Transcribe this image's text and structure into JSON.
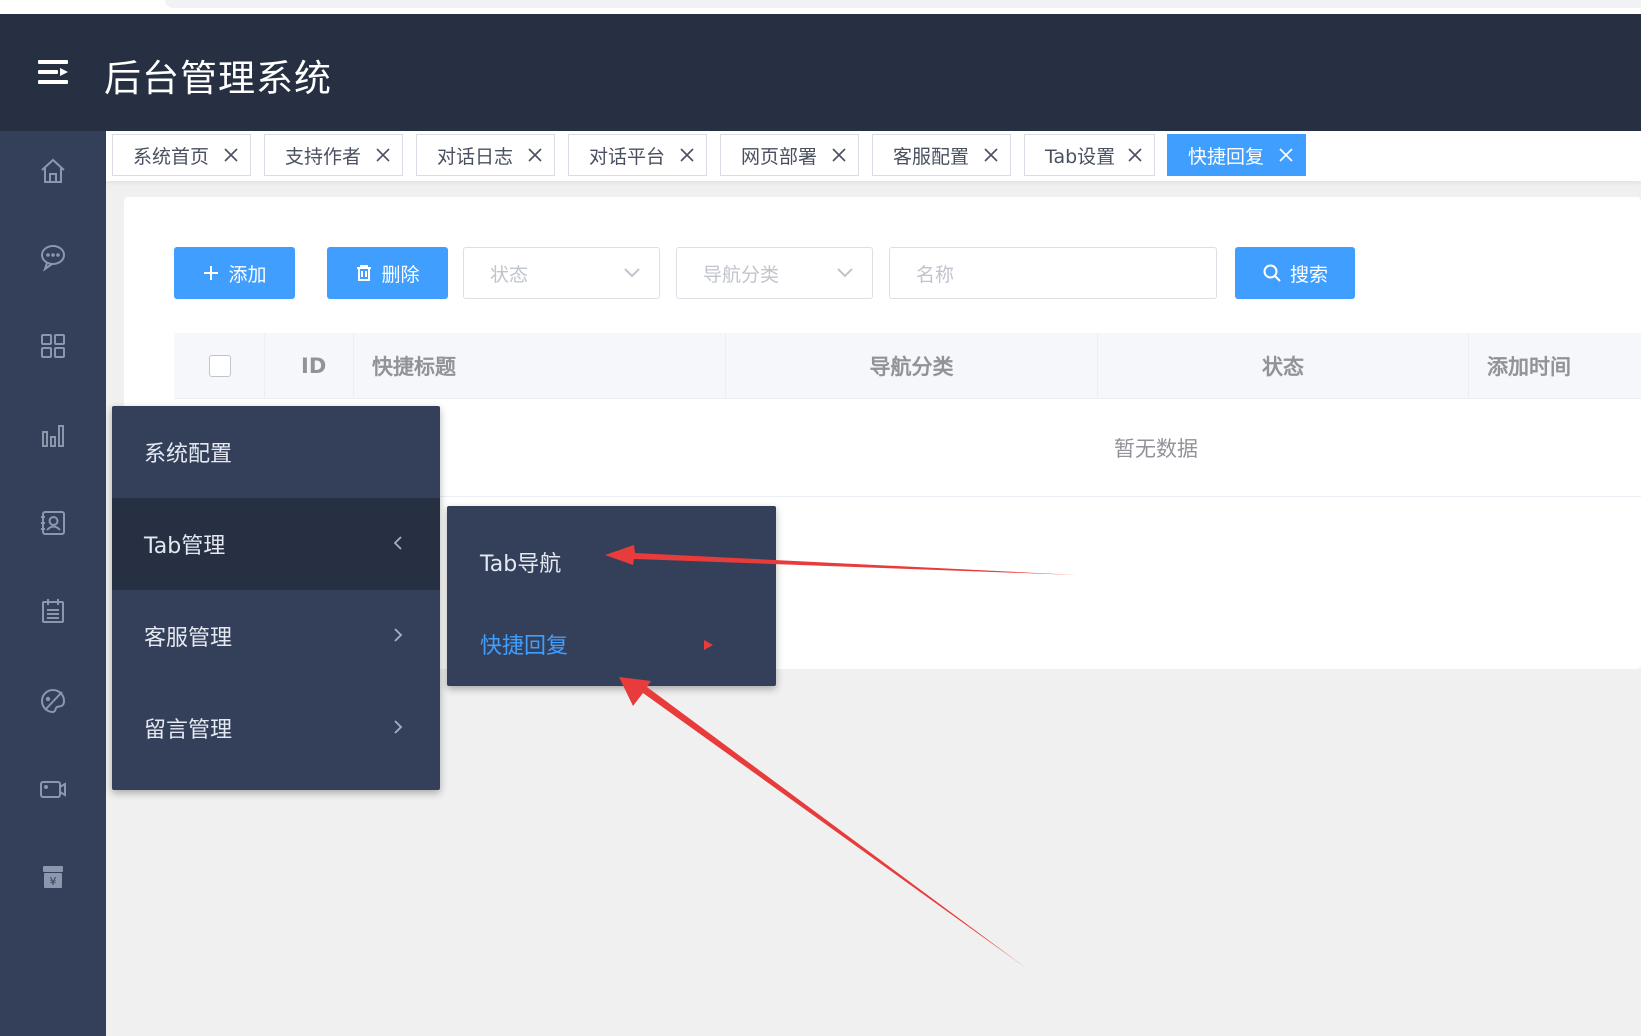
{
  "header": {
    "title": "后台管理系统",
    "menu_icon": "hamburger-menu-icon"
  },
  "sidebar": {
    "icons": [
      "home-icon",
      "chat-icon",
      "grid-icon",
      "bar-chart-icon",
      "contact-card-icon",
      "calendar-icon",
      "palette-icon",
      "video-icon",
      "payment-icon"
    ]
  },
  "tabs": [
    {
      "label": "系统首页"
    },
    {
      "label": "支持作者"
    },
    {
      "label": "对话日志"
    },
    {
      "label": "对话平台"
    },
    {
      "label": "网页部署"
    },
    {
      "label": "客服配置"
    },
    {
      "label": "Tab设置"
    },
    {
      "label": "快捷回复",
      "active": true
    }
  ],
  "toolbar": {
    "add_label": "添加",
    "delete_label": "删除",
    "status_placeholder": "状态",
    "nav_category_placeholder": "导航分类",
    "name_placeholder": "名称",
    "search_label": "搜索"
  },
  "table": {
    "columns": [
      "ID",
      "快捷标题",
      "导航分类",
      "状态",
      "添加时间"
    ],
    "empty_text": "暂无数据"
  },
  "menu": {
    "items": [
      {
        "label": "系统配置"
      },
      {
        "label": "Tab管理",
        "expanded": true
      },
      {
        "label": "客服管理"
      },
      {
        "label": "留言管理"
      }
    ],
    "submenu": [
      {
        "label": "Tab导航"
      },
      {
        "label": "快捷回复",
        "active": true
      }
    ]
  },
  "colors": {
    "header_bg": "#263042",
    "sidebar_bg": "#34405a",
    "primary": "#409eff",
    "annotation_red": "#e83b3b"
  }
}
